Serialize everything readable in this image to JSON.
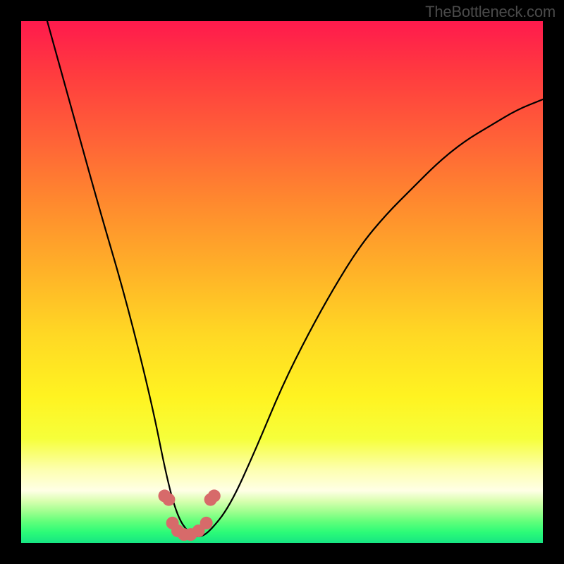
{
  "watermark": "TheBottleneck.com",
  "chart_data": {
    "type": "line",
    "title": "",
    "xlabel": "",
    "ylabel": "",
    "xlim": [
      0,
      100
    ],
    "ylim": [
      0,
      100
    ],
    "grid": false,
    "legend": false,
    "series": [
      {
        "name": "bottleneck-curve",
        "style": "solid-black",
        "x": [
          5,
          10,
          15,
          20,
          25,
          28,
          30,
          32,
          34,
          36,
          40,
          45,
          50,
          55,
          60,
          65,
          70,
          75,
          80,
          85,
          90,
          95,
          100
        ],
        "y": [
          100,
          82,
          64,
          47,
          27,
          12,
          5,
          2,
          1,
          2,
          7,
          18,
          30,
          40,
          49,
          57,
          63,
          68,
          73,
          77,
          80,
          83,
          85
        ]
      },
      {
        "name": "marker-dots",
        "style": "pink-dots",
        "x": [
          27.5,
          28.3,
          29.0,
          30.0,
          31.2,
          32.5,
          34.0,
          35.5,
          36.3,
          37.0
        ],
        "y": [
          9.0,
          8.3,
          3.8,
          2.3,
          1.6,
          1.6,
          2.3,
          3.8,
          8.3,
          9.0
        ]
      }
    ],
    "colors": {
      "curve": "#000000",
      "markers": "#d76a6a",
      "gradient_top": "#ff1a4d",
      "gradient_mid": "#ffd824",
      "gradient_bottom": "#17e582"
    }
  }
}
